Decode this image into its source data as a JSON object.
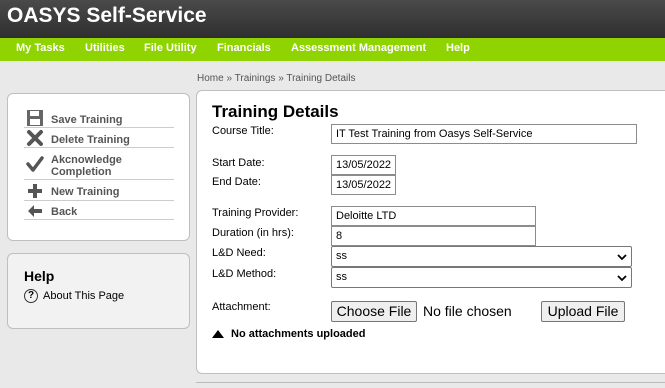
{
  "app": {
    "title": "OASYS Self-Service"
  },
  "nav": {
    "items": [
      {
        "label": "My Tasks"
      },
      {
        "label": "Utilities"
      },
      {
        "label": "File Utility"
      },
      {
        "label": "Financials"
      },
      {
        "label": "Assessment Management"
      },
      {
        "label": "Help"
      }
    ]
  },
  "breadcrumb": {
    "home": "Home",
    "trainings": "Trainings",
    "current": "Training Details",
    "separator": "»"
  },
  "actions": {
    "save": "Save Training",
    "delete": "Delete Training",
    "acknowledge_line1": "Akcnowledge",
    "acknowledge_line2": "Completion",
    "new": "New Training",
    "back": "Back"
  },
  "help": {
    "title": "Help",
    "about": "About This Page"
  },
  "form": {
    "title": "Training Details",
    "course_title_label": "Course Title:",
    "course_title_value": "IT Test Training from Oasys Self-Service",
    "start_date_label": "Start Date:",
    "start_date_value": "13/05/2022",
    "end_date_label": "End Date:",
    "end_date_value": "13/05/2022",
    "provider_label": "Training Provider:",
    "provider_value": "Deloitte LTD",
    "duration_label": "Duration (in hrs):",
    "duration_value": "8",
    "ld_need_label": "L&D Need:",
    "ld_need_value": "ss",
    "ld_method_label": "L&D Method:",
    "ld_method_value": "ss",
    "attachment_label": "Attachment:",
    "choose_file": "Choose File",
    "no_file": "No file chosen",
    "upload_file": "Upload File",
    "no_attachments": "No attachments uploaded"
  }
}
